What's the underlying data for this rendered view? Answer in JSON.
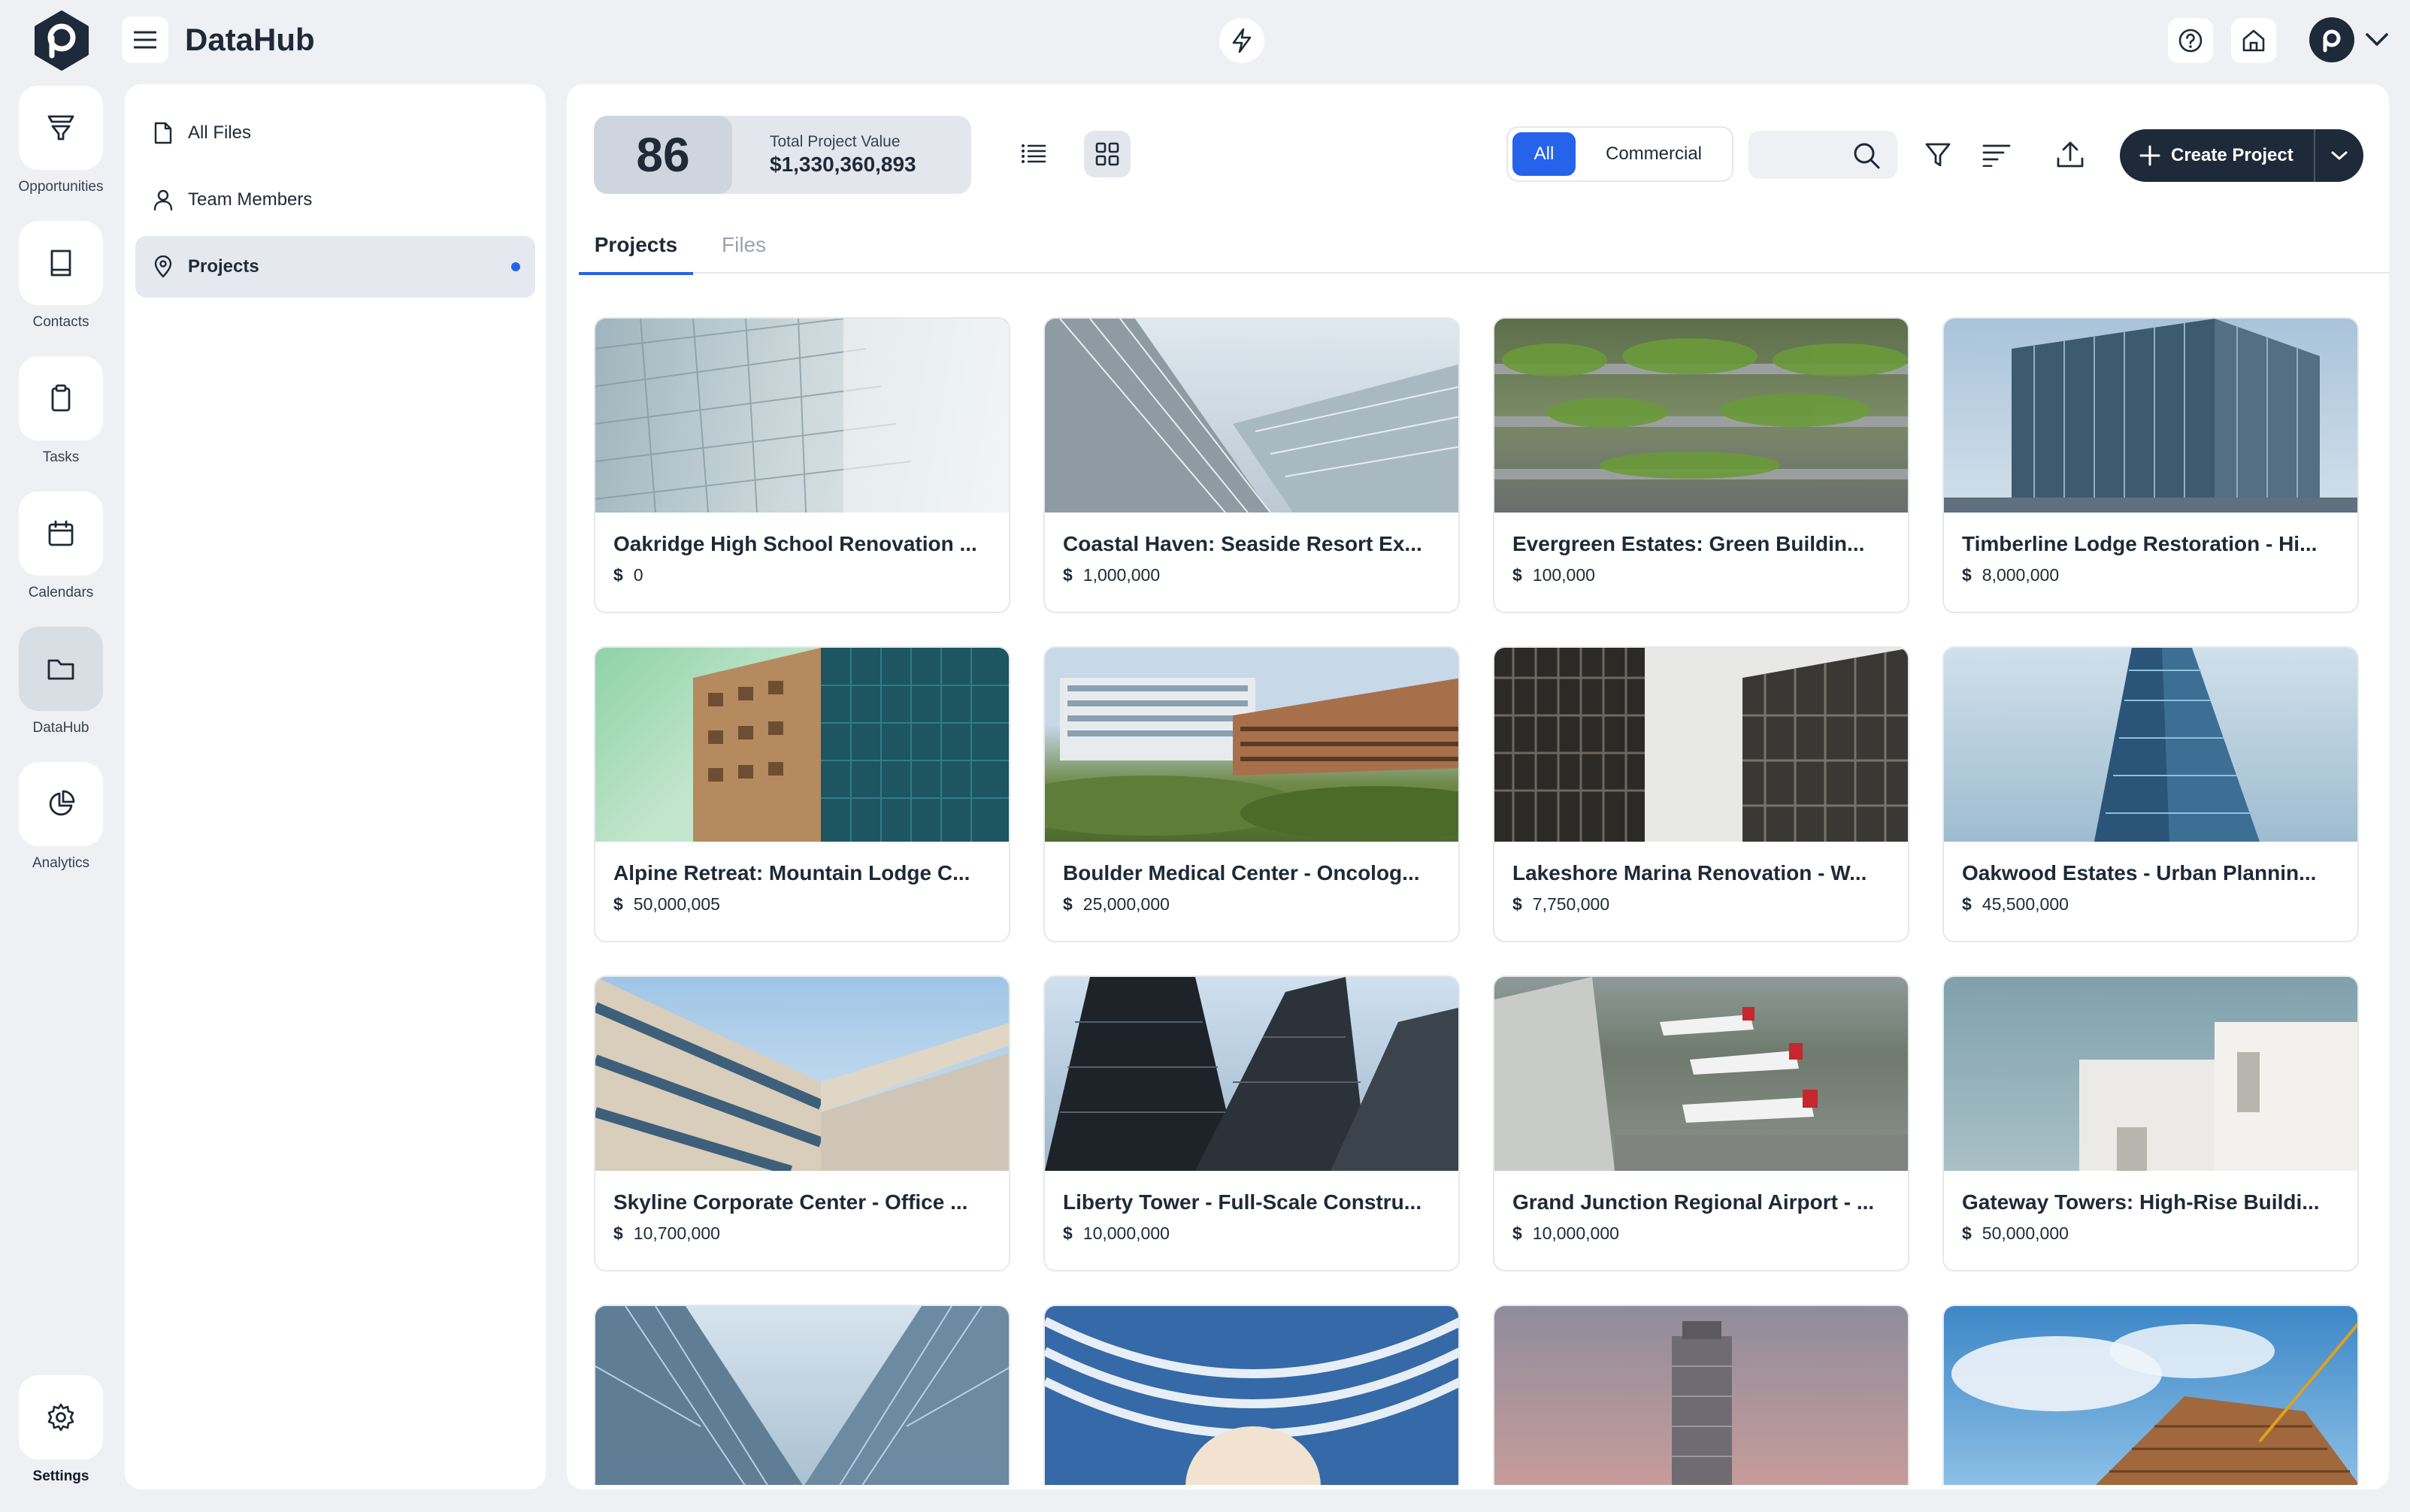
{
  "app": {
    "title": "DataHub"
  },
  "rail": {
    "items": [
      {
        "label": "Opportunities",
        "icon": "funnel-icon"
      },
      {
        "label": "Contacts",
        "icon": "book-icon"
      },
      {
        "label": "Tasks",
        "icon": "clipboard-icon"
      },
      {
        "label": "Calendars",
        "icon": "calendar-icon"
      },
      {
        "label": "DataHub",
        "icon": "folder-icon"
      },
      {
        "label": "Analytics",
        "icon": "pie-chart-icon"
      }
    ],
    "settings_label": "Settings"
  },
  "sidebar": {
    "items": [
      {
        "label": "All Files",
        "icon": "file-icon"
      },
      {
        "label": "Team Members",
        "icon": "user-icon"
      },
      {
        "label": "Projects",
        "icon": "map-pin-icon",
        "active": true
      }
    ]
  },
  "summary": {
    "count": "86",
    "label": "Total Project Value",
    "value": "$1,330,360,893"
  },
  "filter": {
    "all": "All",
    "commercial": "Commercial"
  },
  "search": {
    "placeholder": ""
  },
  "create_button": "Create Project",
  "tabs": [
    {
      "label": "Projects",
      "active": true
    },
    {
      "label": "Files",
      "active": false
    }
  ],
  "currency_symbol": "$",
  "projects": [
    {
      "title": "Oakridge High School Renovation ...",
      "value": "0"
    },
    {
      "title": "Coastal Haven: Seaside Resort Ex...",
      "value": "1,000,000"
    },
    {
      "title": "Evergreen Estates: Green Buildin...",
      "value": "100,000"
    },
    {
      "title": "Timberline Lodge Restoration - Hi...",
      "value": "8,000,000"
    },
    {
      "title": "Alpine Retreat: Mountain Lodge C...",
      "value": "50,000,005"
    },
    {
      "title": "Boulder Medical Center - Oncolog...",
      "value": "25,000,000"
    },
    {
      "title": "Lakeshore Marina Renovation - W...",
      "value": "7,750,000"
    },
    {
      "title": "Oakwood Estates - Urban Plannin...",
      "value": "45,500,000"
    },
    {
      "title": "Skyline Corporate Center - Office ...",
      "value": "10,700,000"
    },
    {
      "title": "Liberty Tower - Full-Scale Constru...",
      "value": "10,000,000"
    },
    {
      "title": "Grand Junction Regional Airport - ...",
      "value": "10,000,000"
    },
    {
      "title": "Gateway Towers: High-Rise Buildi...",
      "value": "50,000,000"
    }
  ],
  "colors": {
    "accent": "#2563eb",
    "dark": "#1e2a3a",
    "background": "#eef0f4"
  }
}
